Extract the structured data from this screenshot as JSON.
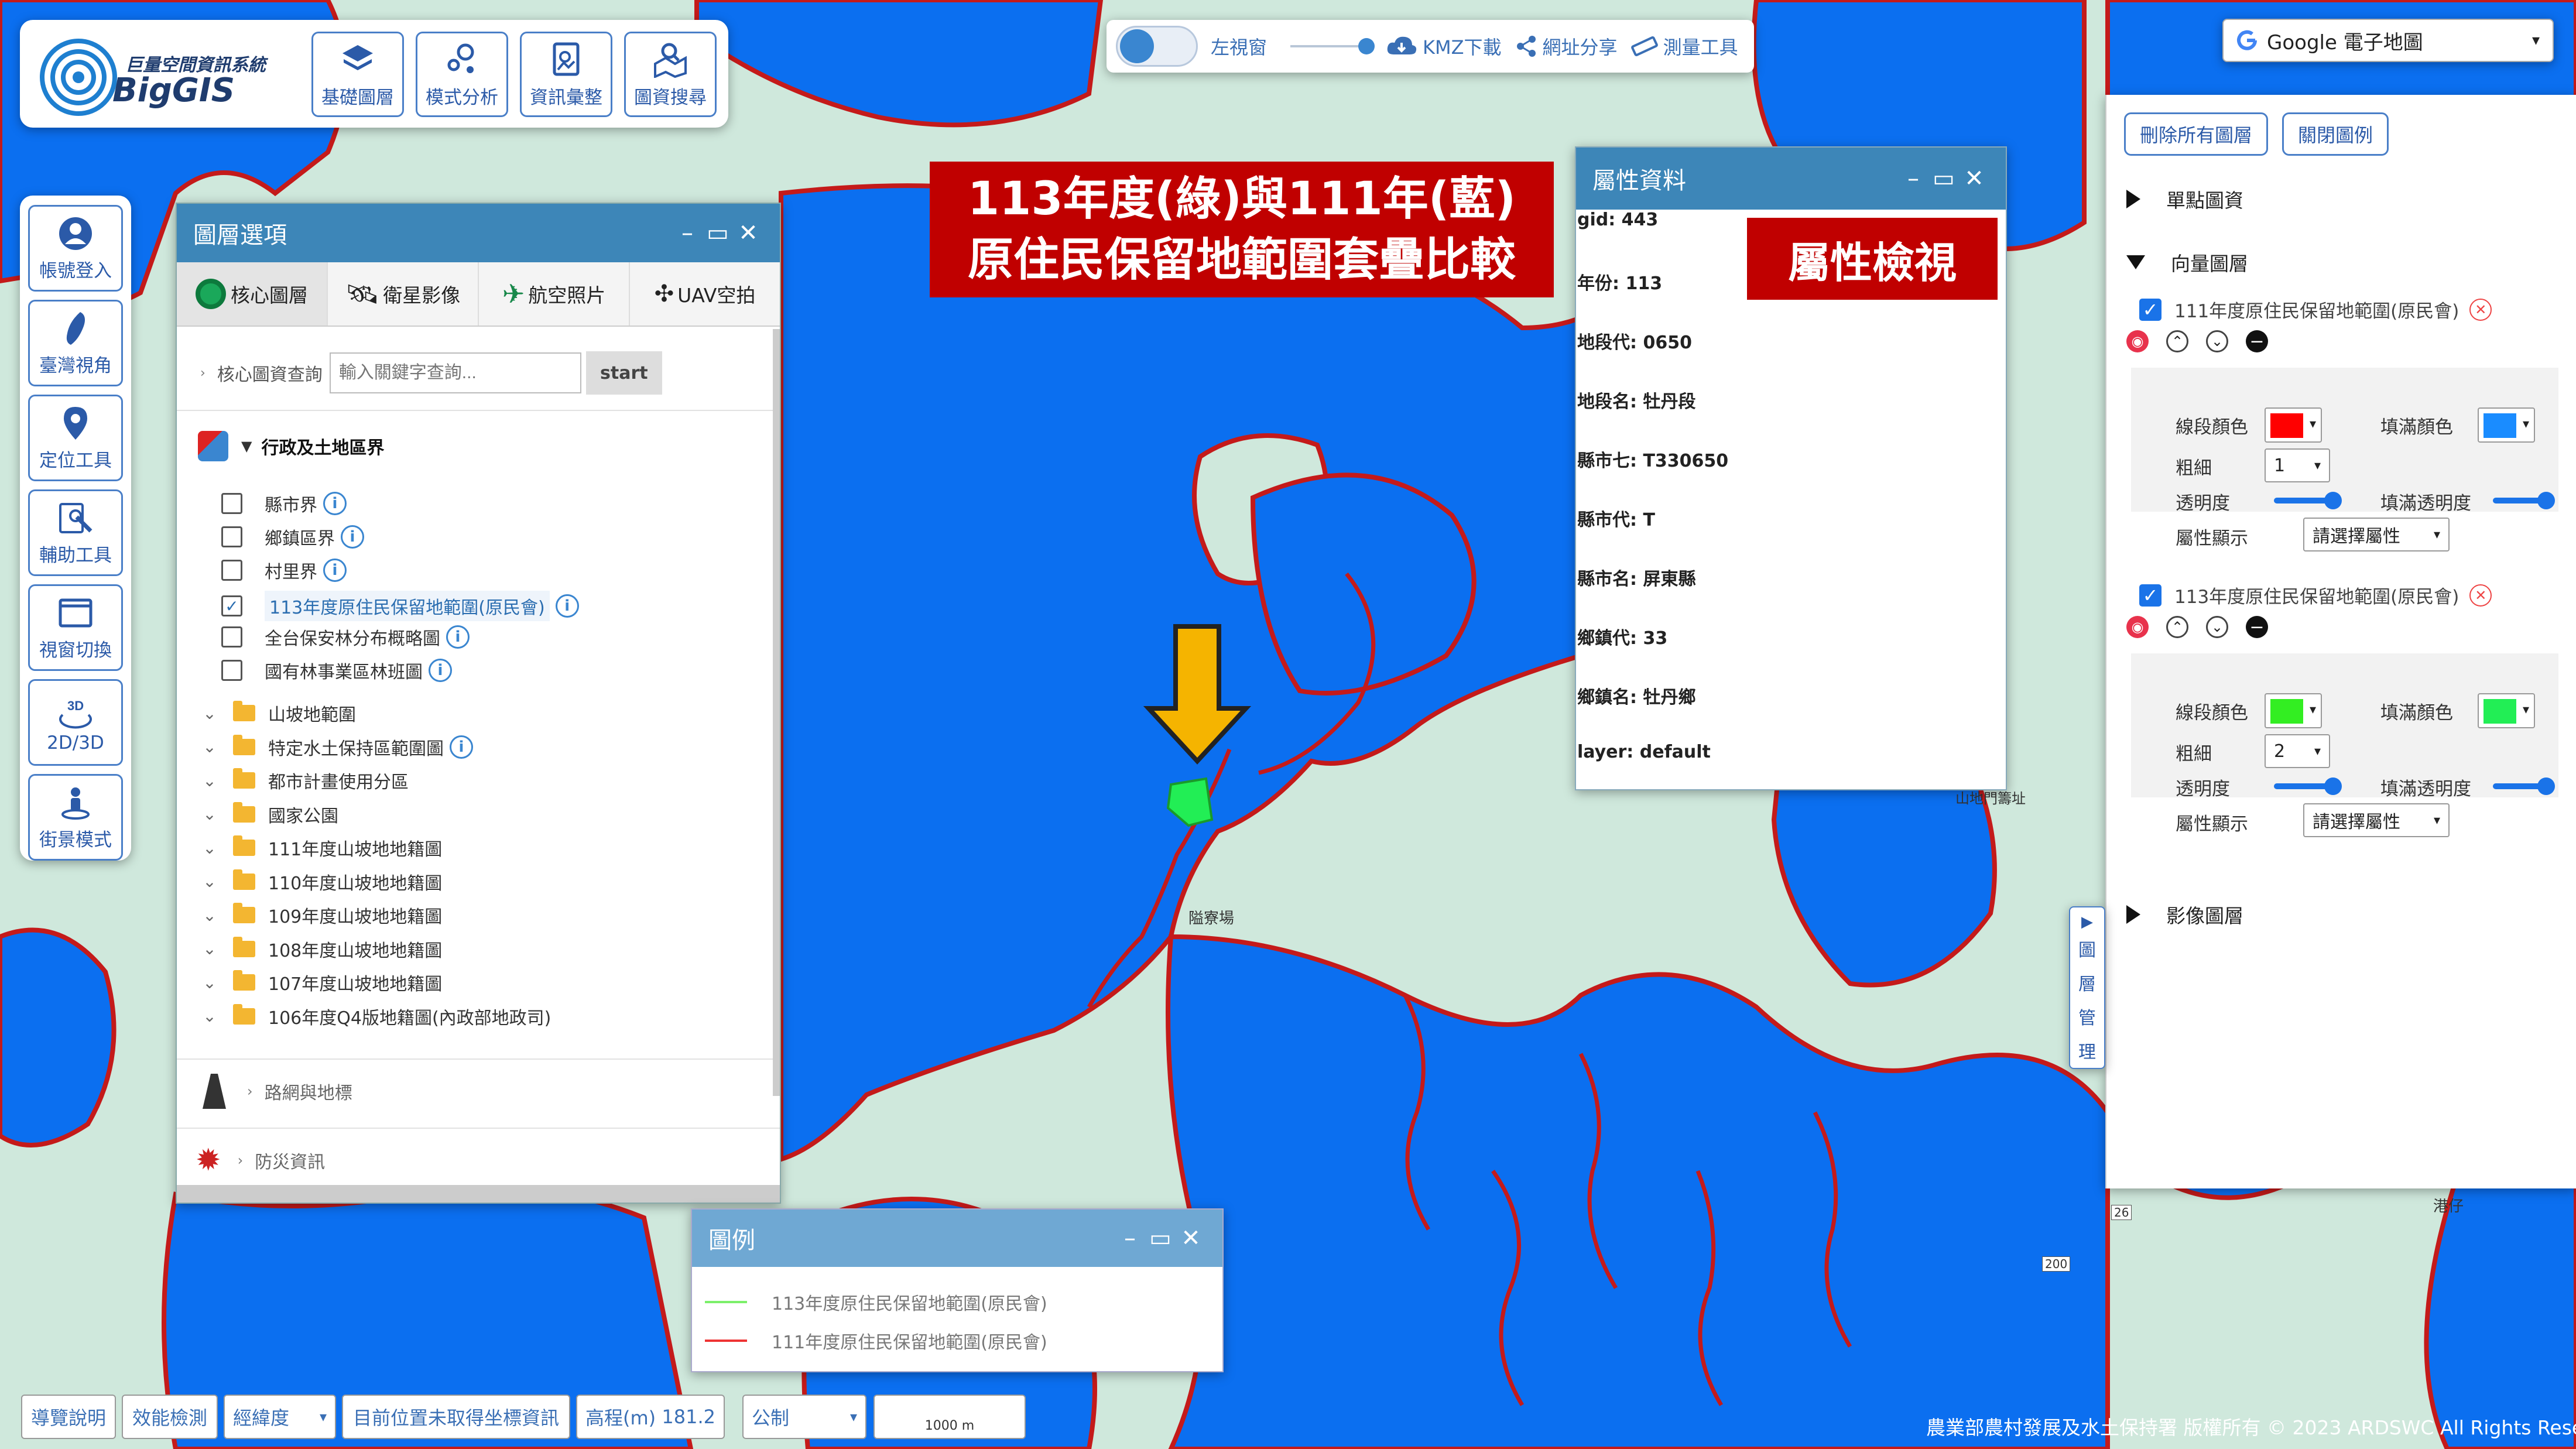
{
  "logo": {
    "title": "巨量空間資訊系統",
    "name": "BigGIS"
  },
  "top_menu": [
    {
      "label": "基礎圖層",
      "icon": "layers-icon"
    },
    {
      "label": "模式分析",
      "icon": "analysis-icon"
    },
    {
      "label": "資訊彙整",
      "icon": "info-summary-icon"
    },
    {
      "label": "圖資搜尋",
      "icon": "map-search-icon"
    }
  ],
  "toolbar": {
    "left_window": "左視窗",
    "kmz": "KMZ下載",
    "share": "網址分享",
    "measure": "測量工具"
  },
  "basemap": {
    "selected": "Google 電子地圖"
  },
  "left_rail": [
    {
      "label": "帳號登入",
      "icon": "user-icon"
    },
    {
      "label": "臺灣視角",
      "icon": "taiwan-icon"
    },
    {
      "label": "定位工具",
      "icon": "location-pin-icon"
    },
    {
      "label": "輔助工具",
      "icon": "tools-icon"
    },
    {
      "label": "視窗切換",
      "icon": "window-icon"
    },
    {
      "label": "2D/3D",
      "icon": "3d-icon"
    },
    {
      "label": "街景模式",
      "icon": "streetview-icon"
    }
  ],
  "layer_panel": {
    "title": "圖層選項",
    "tabs": [
      {
        "label": "核心圖層",
        "icon": "core-layer-icon"
      },
      {
        "label": "衛星影像",
        "icon": "satellite-icon"
      },
      {
        "label": "航空照片",
        "icon": "airplane-icon"
      },
      {
        "label": "UAV空拍",
        "icon": "drone-icon"
      }
    ],
    "search_label": "核心圖資查詢",
    "search_placeholder": "輸入關鍵字查詢...",
    "search_button": "start",
    "group_title": "行政及土地區界",
    "checks": [
      {
        "label": "縣市界",
        "checked": false
      },
      {
        "label": "鄉鎮區界",
        "checked": false
      },
      {
        "label": "村里界",
        "checked": false
      },
      {
        "label": "113年度原住民保留地範圍(原民會)",
        "checked": true
      },
      {
        "label": "全台保安林分布概略圖",
        "checked": false
      },
      {
        "label": "國有林事業區林班圖",
        "checked": false
      }
    ],
    "folders": [
      {
        "label": "山坡地範圍",
        "info": false
      },
      {
        "label": "特定水土保持區範圍圖",
        "info": true
      },
      {
        "label": "都市計畫使用分區",
        "info": false
      },
      {
        "label": "國家公園",
        "info": false
      },
      {
        "label": "111年度山坡地地籍圖",
        "info": false
      },
      {
        "label": "110年度山坡地地籍圖",
        "info": false
      },
      {
        "label": "109年度山坡地地籍圖",
        "info": false
      },
      {
        "label": "108年度山坡地地籍圖",
        "info": false
      },
      {
        "label": "107年度山坡地地籍圖",
        "info": false
      },
      {
        "label": "106年度Q4版地籍圖(內政部地政司)",
        "info": false
      }
    ],
    "collapsed_groups": [
      "路網與地標",
      "防災資訊"
    ]
  },
  "annotation_compare": {
    "line1": "113年度(綠)與111年(藍)",
    "line2": "原住民保留地範圍套疊比較"
  },
  "annotation_attr": "屬性檢視",
  "attr_panel": {
    "title": "屬性資料",
    "rows": [
      "gid: 443",
      "年份: 113",
      "地段代: 0650",
      "地段名: 牡丹段",
      "縣市七: T330650",
      "縣市代: T",
      "縣市名: 屏東縣",
      "鄉鎮代: 33",
      "鄉鎮名: 牡丹鄉",
      "layer: default"
    ]
  },
  "right_panel": {
    "btn_delete_all": "刪除所有圖層",
    "btn_close_legend": "關閉圖例",
    "section_single": "單點圖資",
    "section_vector": "向量圖層",
    "section_image": "影像圖層",
    "labels": {
      "line_color": "線段顏色",
      "fill_color": "填滿顏色",
      "thickness": "粗細",
      "opacity": "透明度",
      "fill_opacity": "填滿透明度",
      "attr_display": "屬性顯示",
      "attr_placeholder": "請選擇屬性"
    },
    "layers": [
      {
        "name": "111年度原住民保留地範圍(原民會)",
        "line_color": "#ff0000",
        "fill_color": "#1a8cff",
        "thickness": "1"
      },
      {
        "name": "113年度原住民保留地範圍(原民會)",
        "line_color": "#33ee22",
        "fill_color": "#22ee55",
        "thickness": "2"
      }
    ],
    "side_tab": [
      "圖",
      "層",
      "管",
      "理"
    ]
  },
  "legend": {
    "title": "圖例",
    "items": [
      {
        "label": "113年度原住民保留地範圍(原民會)",
        "color": "#7cf06a"
      },
      {
        "label": "111年度原住民保留地範圍(原民會)",
        "color": "#e33"
      }
    ]
  },
  "bottom_bar": {
    "guide": "導覽說明",
    "perf": "效能檢測",
    "coord_type": "經緯度",
    "coord_status": "目前位置未取得坐標資訊",
    "elev_label": "高程(m)",
    "elev_value": "181.2",
    "unit": "公制",
    "scale": "1000 m"
  },
  "map_labels": {
    "place1": "隘寮場",
    "place2": "山地門籌址",
    "place3": "港仔",
    "road1": "26",
    "road2": "200"
  },
  "credit": "農業部農村發展及水土保持署 版權所有 © 2023 ARDSWC All Rights Reserved.",
  "colors": {
    "primary": "#3d86b8",
    "map_blue": "#0b6ff0",
    "map_green": "#cfe8dc",
    "annotation_red": "#c00000",
    "arrow": "#f5b400"
  }
}
